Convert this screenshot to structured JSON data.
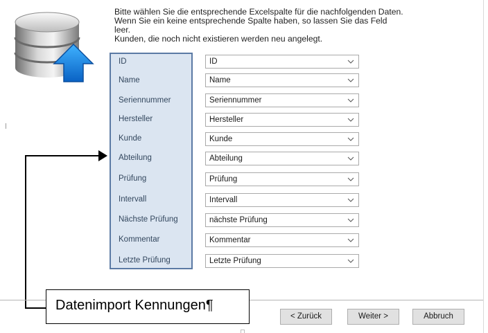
{
  "instructions": {
    "line1": "Bitte wählen Sie die entsprechende Excelspalte für die nachfolgenden Daten.",
    "line2": "Wenn Sie ein keine entsprechende Spalte haben, so lassen Sie das Feld",
    "line3": "leer.",
    "line4": "Kunden, die noch nicht existieren werden neu angelegt."
  },
  "fields": [
    {
      "label": "ID",
      "value": "ID"
    },
    {
      "label": "Name",
      "value": "Name"
    },
    {
      "label": "Seriennummer",
      "value": "Seriennummer"
    },
    {
      "label": "Hersteller",
      "value": "Hersteller"
    },
    {
      "label": "Kunde",
      "value": "Kunde"
    },
    {
      "label": "Abteilung",
      "value": "Abteilung"
    },
    {
      "label": "Prüfung",
      "value": "Prüfung"
    },
    {
      "label": "Intervall",
      "value": "Intervall"
    },
    {
      "label": "Nächste Prüfung",
      "value": "nächste Prüfung"
    },
    {
      "label": "Kommentar",
      "value": "Kommentar"
    },
    {
      "label": "Letzte Prüfung",
      "value": "Letzte Prüfung"
    }
  ],
  "callout": {
    "text": "Datenimport Kennungen¶"
  },
  "buttons": {
    "back": "< Zurück",
    "next": "Weiter >",
    "cancel": "Abbruch"
  },
  "icons": {
    "header": "database-import-icon",
    "dropdown": "chevron-down-icon"
  },
  "colors": {
    "label_panel": "#dbe5f1",
    "label_panel_border": "#5b7aa4",
    "import_arrow": "#1e90e6"
  }
}
